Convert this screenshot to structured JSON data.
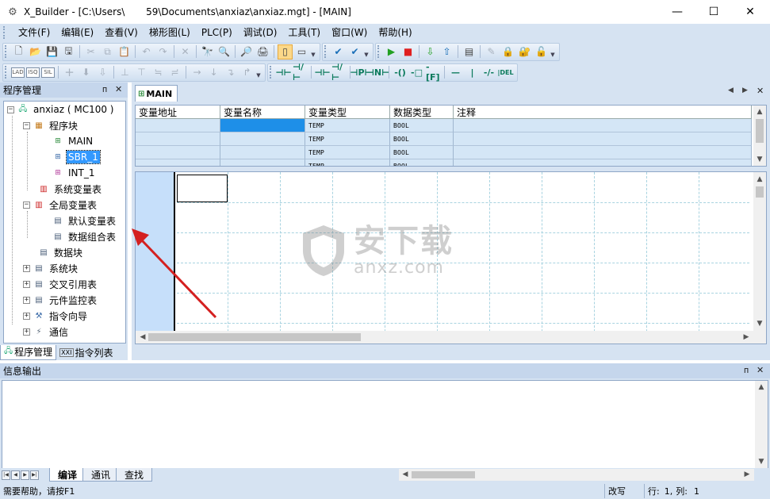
{
  "window": {
    "title": "X_Builder - [C:\\Users\\        59\\Documents\\anxiaz\\anxiaz.mgt] - [MAIN]",
    "title_display": "X_Builder - [C:\\Users\\\u0013       59\\Documents\\anxiaz\\anxiaz.mgt] - [MAIN]",
    "minimize": "—",
    "maximize": "☐",
    "close": "✕"
  },
  "menu": [
    "文件(F)",
    "编辑(E)",
    "查看(V)",
    "梯形图(L)",
    "PLC(P)",
    "调试(D)",
    "工具(T)",
    "窗口(W)",
    "帮助(H)"
  ],
  "left_panel": {
    "title": "程序管理",
    "pin": "ᴨ",
    "close": "✕",
    "tree": {
      "root": "anxiaz ( MC100 )",
      "program_block": "程序块",
      "main": "MAIN",
      "sbr": "SBR_1",
      "int": "INT_1",
      "sys_var": "系统变量表",
      "global_var": "全局变量表",
      "default_var": "默认变量表",
      "data_group": "数据组合表",
      "data_block": "数据块",
      "system_block": "系统块",
      "cross_ref": "交叉引用表",
      "monitor": "元件监控表",
      "wizard": "指令向导",
      "comm": "通信"
    },
    "tabs": [
      "程序管理",
      "指令列表"
    ]
  },
  "editor": {
    "tab": "MAIN",
    "nav_left": "◀",
    "nav_right": "▶",
    "close": "✕",
    "var_headers": [
      "变量地址",
      "变量名称",
      "变量类型",
      "数据类型",
      "注释"
    ],
    "var_rows": [
      [
        "",
        "",
        "TEMP",
        "BOOL",
        ""
      ],
      [
        "",
        "",
        "TEMP",
        "BOOL",
        ""
      ],
      [
        "",
        "",
        "TEMP",
        "BOOL",
        ""
      ],
      [
        "",
        "",
        "TEMP",
        "BOOL",
        ""
      ]
    ]
  },
  "info_panel": {
    "title": "信息输出",
    "tabs": [
      "编译",
      "通讯",
      "查找"
    ]
  },
  "status": {
    "help": "需要帮助，请按F1",
    "mode": "改写",
    "row_label": "行:",
    "row": "1,",
    "col_label": "列:",
    "col": "1"
  },
  "watermark": {
    "text": "安下载",
    "sub": "anxz.com"
  },
  "colors": {
    "chrome": "#d6e3f2",
    "selection": "#3399ff",
    "grid": "#a8d3e0",
    "rail": "#c6dffa",
    "arrow": "#d42020"
  }
}
